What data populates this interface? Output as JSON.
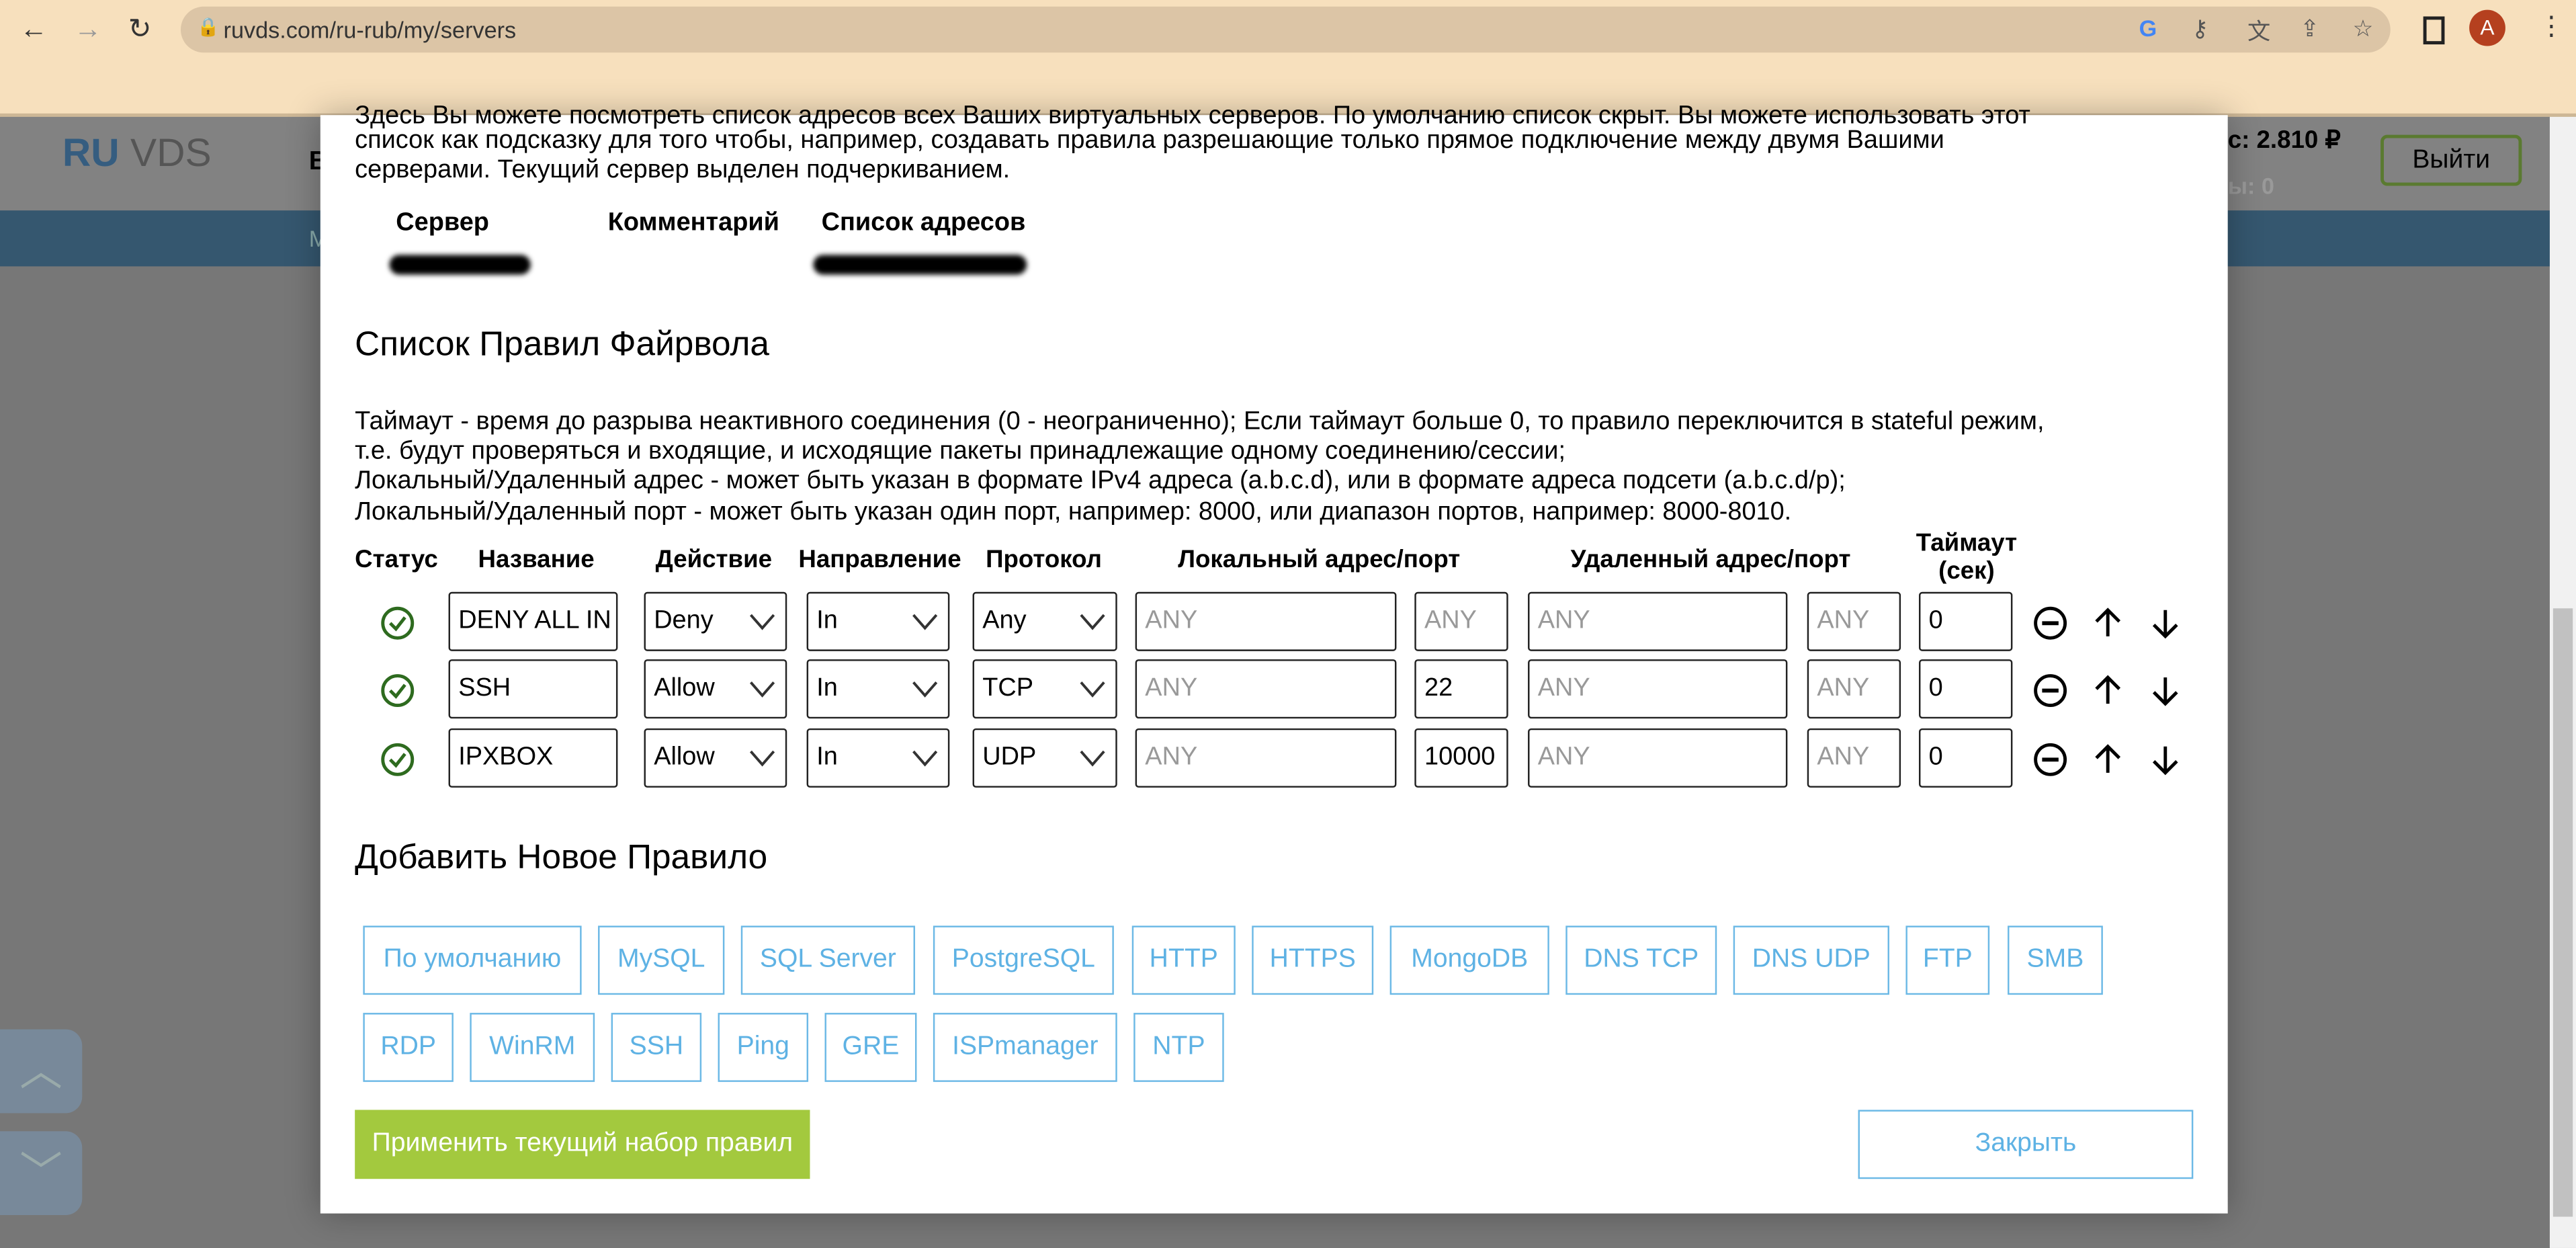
{
  "browser": {
    "url": "ruvds.com/ru-rub/my/servers",
    "profile_initial": "A",
    "icons": [
      "back-icon",
      "forward-icon",
      "reload-icon",
      "lock-icon",
      "google-icon",
      "key-icon",
      "translate-icon",
      "share-icon",
      "star-icon",
      "sidepanel-icon",
      "menu-icon"
    ]
  },
  "site": {
    "logo": {
      "ru": "RU",
      "vds": "VDS"
    },
    "nav_partial": "В",
    "band_partial": "М",
    "balance_partial": "с: 2.810 ₽",
    "bonus_partial": "ы: 0",
    "logout": "Выйти"
  },
  "modal": {
    "intro_line1_cut": "Здесь Вы можете посмотреть список адресов всех Ваших виртуальных серверов. По умолчанию список скрыт. Вы можете использовать этот",
    "intro_line2": "список как подсказку для того чтобы, например, создавать правила разрешающие только прямое подключение между двумя Вашими",
    "intro_line3": "серверами. Текущий сервер выделен подчеркиванием.",
    "servers_header": {
      "server": "Сервер",
      "comment": "Комментарий",
      "addresses": "Список адресов"
    },
    "rules_title": "Список Правил Файрвола",
    "help": [
      "Таймаут - время до разрыва неактивного соединения (0 - неограниченно); Если таймаут больше 0, то правило переключится в stateful режим,",
      "т.е. будут проверяться и входящие, и исходящие пакеты принадлежащие одному соединению/сессии;",
      "Локальный/Удаленный адрес - может быть указан в формате IPv4 адреса (a.b.c.d), или в формате адреса подсети (a.b.c.d/p);",
      "Локальный/Удаленный порт - может быть указан один порт, например: 8000, или диапазон портов, например: 8000-8010."
    ],
    "columns": {
      "status": "Статус",
      "name": "Название",
      "action": "Действие",
      "direction": "Направление",
      "protocol": "Протокол",
      "local": "Локальный адрес/порт",
      "remote": "Удаленный адрес/порт",
      "timeout1": "Таймаут",
      "timeout2": "(сек)"
    },
    "placeholder": "ANY",
    "rules": [
      {
        "status": "enabled",
        "name": "DENY ALL IN",
        "action": "Deny",
        "direction": "In",
        "protocol": "Any",
        "local_addr": "",
        "local_port": "",
        "remote_addr": "",
        "remote_port": "",
        "timeout": "0"
      },
      {
        "status": "enabled",
        "name": "SSH",
        "action": "Allow",
        "direction": "In",
        "protocol": "TCP",
        "local_addr": "",
        "local_port": "22",
        "remote_addr": "",
        "remote_port": "",
        "timeout": "0"
      },
      {
        "status": "enabled",
        "name": "IPXBOX",
        "action": "Allow",
        "direction": "In",
        "protocol": "UDP",
        "local_addr": "",
        "local_port": "10000",
        "remote_addr": "",
        "remote_port": "",
        "timeout": "0"
      }
    ],
    "add_title": "Добавить Новое Правило",
    "presets_row1": [
      "По умолчанию",
      "MySQL",
      "SQL Server",
      "PostgreSQL",
      "HTTP",
      "HTTPS",
      "MongoDB",
      "DNS TCP",
      "DNS UDP",
      "FTP",
      "SMB"
    ],
    "presets_row2": [
      "RDP",
      "WinRM",
      "SSH",
      "Ping",
      "GRE",
      "ISPmanager",
      "NTP"
    ],
    "apply": "Применить текущий набор правил",
    "close": "Закрыть"
  },
  "colors": {
    "accent_green": "#a3c93e",
    "link_blue": "#5eb2e4",
    "status_green": "#2e6b1f",
    "chrome_bg": "#f7e0bd"
  }
}
